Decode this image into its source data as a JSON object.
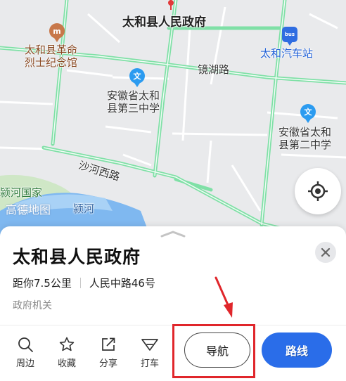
{
  "map": {
    "labels": {
      "government": "太和县人民政府",
      "memorial": "太和县革命\n烈士纪念馆",
      "bus_station": "太和汽车站",
      "road_jinghu": "镜湖路",
      "school_three": "安徽省太和\n县第三中学",
      "school_two": "安徽省太和\n县第二中学",
      "road_shahe": "沙河西路",
      "river": "颍河",
      "park": "颍河国家",
      "watermark": "高德地图"
    },
    "icons": {
      "school_glyph": "文",
      "memorial_glyph": "m",
      "bus_glyph": "bus"
    },
    "colors": {
      "road_green": "#7fe0a6",
      "water": "#7fb8f0",
      "park": "#cfe7c6"
    }
  },
  "sheet": {
    "title": "太和县人民政府",
    "distance": "距你7.5公里",
    "address": "人民中路46号",
    "category": "政府机关",
    "actions": [
      {
        "label": "周边",
        "icon": "search-icon"
      },
      {
        "label": "收藏",
        "icon": "star-icon"
      },
      {
        "label": "分享",
        "icon": "share-icon"
      },
      {
        "label": "打车",
        "icon": "taxi-icon"
      }
    ],
    "nav_label": "导航",
    "route_label": "路线",
    "accent": "#2a6de9",
    "annotation_color": "#e0262b"
  }
}
